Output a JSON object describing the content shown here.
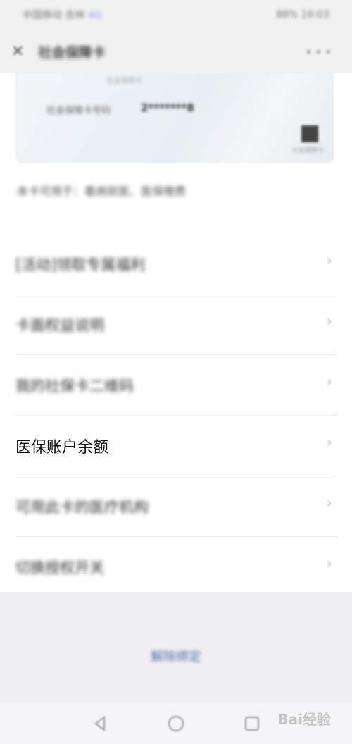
{
  "status_bar": {
    "left_text": "中国移动 吉林",
    "left_highlight": "4G",
    "right_text": "88% 16:03"
  },
  "title_bar": {
    "close_icon": "close-icon",
    "title": "社会保障卡",
    "more_icon": "more-dots-icon"
  },
  "card": {
    "top_line": "社会保障卡",
    "number_label": "社会保障卡号码",
    "number_value": "2*******8",
    "qr_icon": "qr-code-icon",
    "qr_caption": "社会保障卡"
  },
  "hint": "本卡可用于：看病就医、医保缴费",
  "menu": [
    {
      "label": "[活动]领取专属福利",
      "chevron": "chevron-right-icon"
    },
    {
      "label": "卡面权益说明",
      "chevron": "chevron-right-icon"
    },
    {
      "label": "我的社保卡二维码",
      "chevron": "chevron-right-icon"
    },
    {
      "label": "医保账户余额",
      "chevron": "chevron-right-icon"
    },
    {
      "label": "可用此卡的医疗机构",
      "chevron": "chevron-right-icon"
    },
    {
      "label": "切换授权开关",
      "chevron": "chevron-right-icon"
    }
  ],
  "footer_link": "解除绑定",
  "nav": {
    "back_icon": "back-triangle-icon",
    "home_icon": "home-circle-icon",
    "recent_icon": "recent-square-icon"
  },
  "watermark": "Bai经验"
}
